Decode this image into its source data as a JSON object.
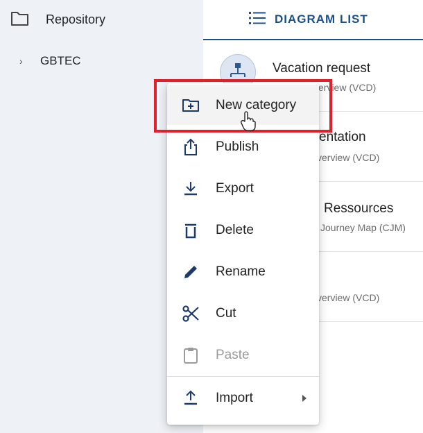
{
  "sidebar": {
    "root_label": "Repository",
    "items": [
      {
        "label": "GBTEC",
        "expand_glyph": "›"
      }
    ]
  },
  "tab": {
    "label": "DIAGRAM LIST",
    "icon": "list-icon"
  },
  "diagrams": [
    {
      "title": "Vacation request",
      "subtitle": "verview (VCD)"
    },
    {
      "title": "entation",
      "subtitle": "verview (VCD)"
    },
    {
      "title": "Ressources",
      "subtitle": "Journey Map (CJM)"
    },
    {
      "title": "",
      "subtitle": "verview (VCD)"
    }
  ],
  "context_menu": {
    "items": [
      {
        "label": "New category",
        "icon": "new-folder-icon",
        "enabled": true
      },
      {
        "label": "Publish",
        "icon": "share-icon",
        "enabled": true
      },
      {
        "label": "Export",
        "icon": "download-icon",
        "enabled": true
      },
      {
        "label": "Delete",
        "icon": "trash-icon",
        "enabled": true
      },
      {
        "label": "Rename",
        "icon": "pencil-icon",
        "enabled": true
      },
      {
        "label": "Cut",
        "icon": "scissors-icon",
        "enabled": true
      },
      {
        "label": "Paste",
        "icon": "clipboard-icon",
        "enabled": false
      },
      {
        "label": "Import",
        "icon": "upload-icon",
        "enabled": true,
        "has_submenu": true
      }
    ]
  },
  "colors": {
    "accent": "#1b4f8a",
    "highlight": "#e0202a",
    "sidebar_bg": "#eef1f6"
  }
}
